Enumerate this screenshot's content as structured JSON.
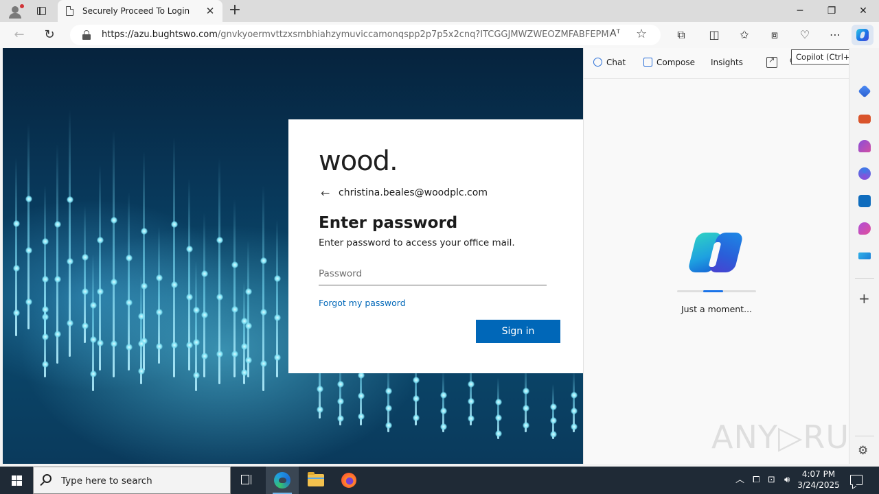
{
  "browser": {
    "tab_title": "Securely Proceed To Login",
    "url_host": "https://azu.bughtswo.com",
    "url_path": "/gnvkyoermvttzxsmbhiahzymuviccamonqspp2p7p5x2cnq?ITCGGJMWZWEOZMFABFEPMLT...",
    "new_tab_label": "+",
    "reader_label": "Aᵀ",
    "copilot_tooltip": "Copilot (Ctrl+Shift+.)"
  },
  "login": {
    "logo_text": "wood.",
    "back_arrow": "←",
    "email": "christina.beales@woodplc.com",
    "heading": "Enter password",
    "subtext": "Enter password to access your office mail.",
    "password_placeholder": "Password",
    "password_value": "",
    "forgot_link": "Forgot my password",
    "signin_button": "Sign in"
  },
  "copilot_pane": {
    "tabs": [
      "Chat",
      "Compose",
      "Insights"
    ],
    "loading_text": "Just a moment...",
    "progress_fraction": 0.25,
    "watermark": "ANY▷RUN"
  },
  "taskbar": {
    "search_placeholder": "Type here to search",
    "time": "4:07 PM",
    "date": "3/24/2025"
  },
  "colors": {
    "accent": "#0067b8",
    "copilot_blue": "#1a73e8",
    "taskbar_bg": "#1f2a36"
  },
  "icons": {
    "sidebar": [
      "shopping-tag-icon",
      "toolbox-icon",
      "chess-icon",
      "copilot-office-icon",
      "outlook-icon",
      "designer-icon",
      "send-icon"
    ]
  }
}
